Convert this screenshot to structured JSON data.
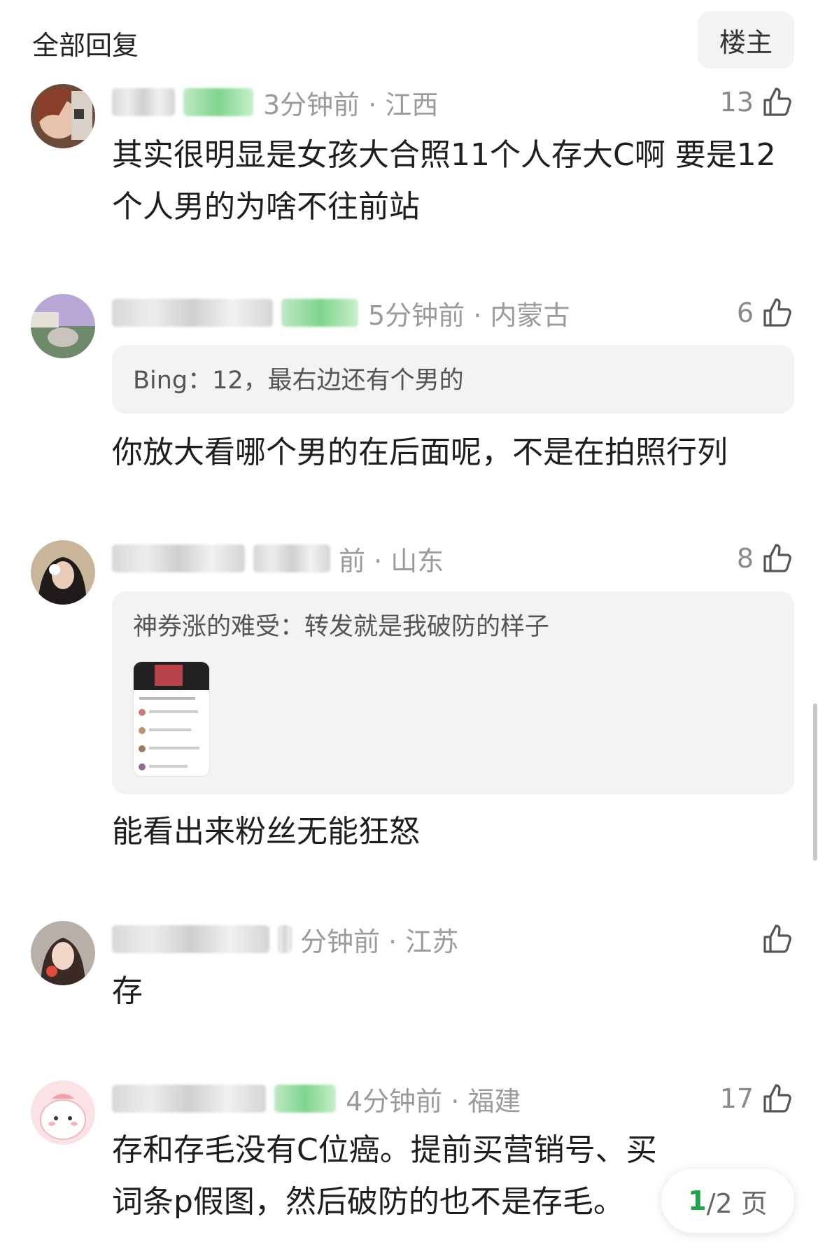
{
  "header": {
    "title": "全部回复",
    "author_button": "楼主"
  },
  "comments": [
    {
      "time_location": "3分钟前 · 江西",
      "likes": "13",
      "content": "其实很明显是女孩大合照11个人存大C啊 要是12个人男的为啥不往前站"
    },
    {
      "time_location": "5分钟前 · 内蒙古",
      "likes": "6",
      "quote": "Bing：12，最右边还有个男的",
      "content": "你放大看哪个男的在后面呢，不是在拍照行列"
    },
    {
      "time_location": "前 · 山东",
      "likes": "8",
      "quote": "神券涨的难受：转发就是我破防的样子",
      "content": "能看出来粉丝无能狂怒"
    },
    {
      "time_location": "分钟前 · 江苏",
      "likes": "",
      "content": "存"
    },
    {
      "time_location": "4分钟前 · 福建",
      "likes": "17",
      "content": "存和存毛没有C位癌。提前买营销号、买词条p假图，然后破防的也不是存毛。"
    }
  ],
  "pager": {
    "current": "1",
    "total": "/2 页"
  },
  "icons": {
    "like": "thumbs-up-icon"
  },
  "colors": {
    "accent_green": "#1fa64a",
    "meta_gray": "#9b9b9b",
    "quote_bg": "#f3f3f3"
  }
}
